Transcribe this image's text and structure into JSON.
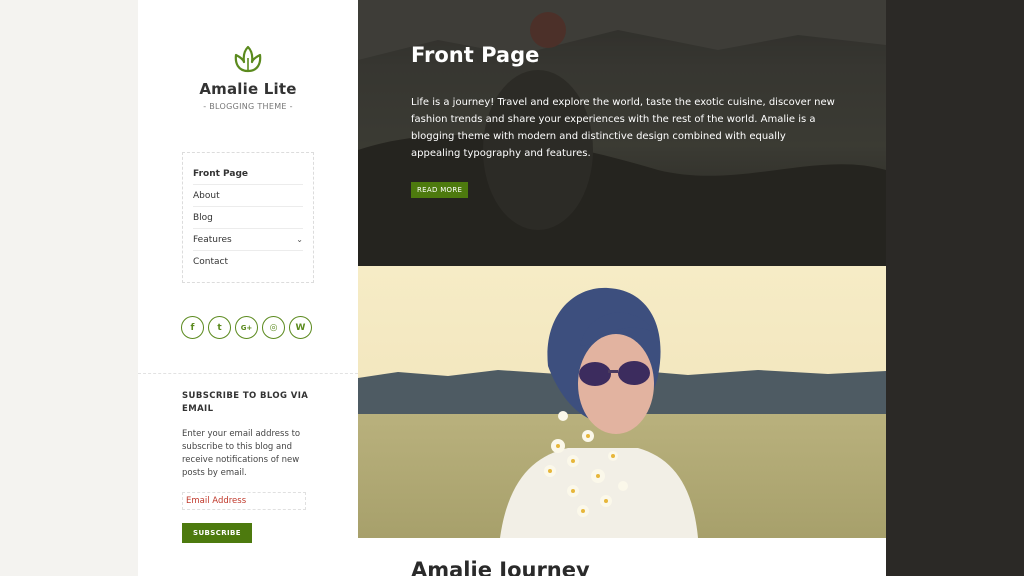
{
  "site": {
    "title": "Amalie Lite",
    "description": "- BLOGGING THEME -"
  },
  "menu": {
    "items": [
      {
        "label": "Front Page",
        "active": true
      },
      {
        "label": "About"
      },
      {
        "label": "Blog"
      },
      {
        "label": "Features",
        "has_submenu": true
      },
      {
        "label": "Contact"
      }
    ]
  },
  "social": {
    "icons": [
      "facebook-icon",
      "twitter-icon",
      "google-plus-icon",
      "dribbble-icon",
      "wordpress-icon"
    ],
    "glyphs": [
      "f",
      "t",
      "G+",
      "◎",
      "W"
    ]
  },
  "widget": {
    "title": "SUBSCRIBE TO BLOG VIA EMAIL",
    "text": "Enter your email address to subscribe to this blog and receive notifications of new posts by email.",
    "email_placeholder": "Email Address",
    "button_label": "SUBSCRIBE"
  },
  "hero": {
    "title": "Front Page",
    "text": "Life is a journey! Travel and explore the world, taste the exotic cuisine, discover new fashion trends and share your experiences with the rest of the world. Amalie is a blogging theme with modern and distinctive design combined with equally appealing typography and features.",
    "button_label": "READ MORE"
  },
  "post": {
    "title": "Amalie Journey"
  },
  "colors": {
    "accent": "#4d7a0e",
    "dark": "#2b2926"
  }
}
